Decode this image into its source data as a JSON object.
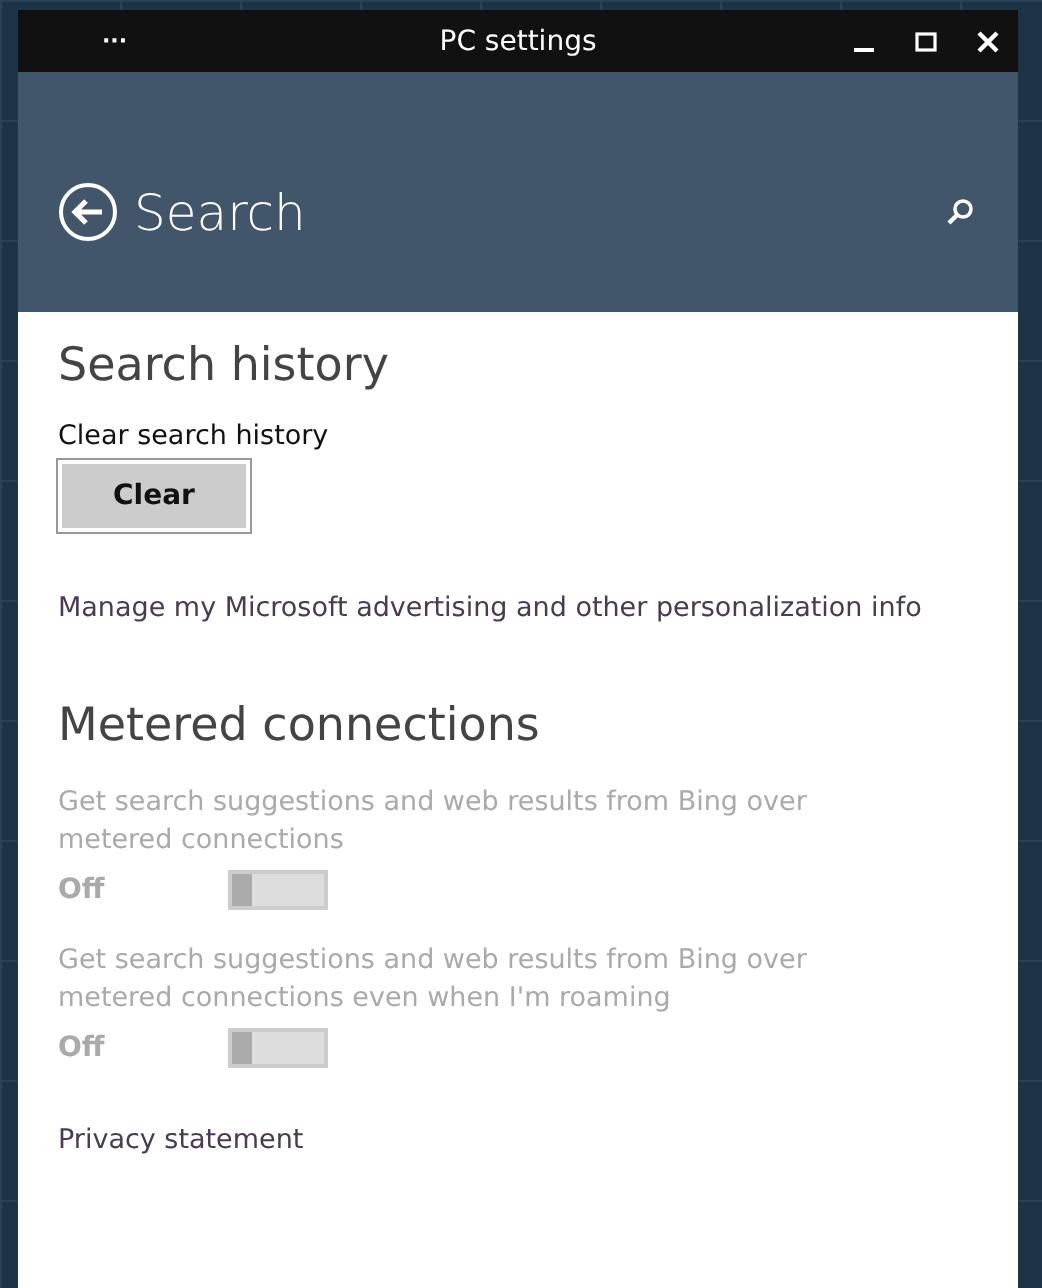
{
  "window": {
    "title": "PC settings",
    "menu": "···"
  },
  "header": {
    "title": "Search"
  },
  "search_history": {
    "heading": "Search history",
    "label": "Clear search history",
    "button": "Clear",
    "link": "Manage my Microsoft advertising and other personalization info"
  },
  "metered": {
    "heading": "Metered connections",
    "settings": [
      {
        "label": "Get search suggestions and web results from Bing over metered connections",
        "state": "Off",
        "on": false,
        "disabled": true
      },
      {
        "label": "Get search suggestions and web results from Bing over metered connections even when I'm roaming",
        "state": "Off",
        "on": false,
        "disabled": true
      }
    ]
  },
  "privacy_link": "Privacy statement"
}
